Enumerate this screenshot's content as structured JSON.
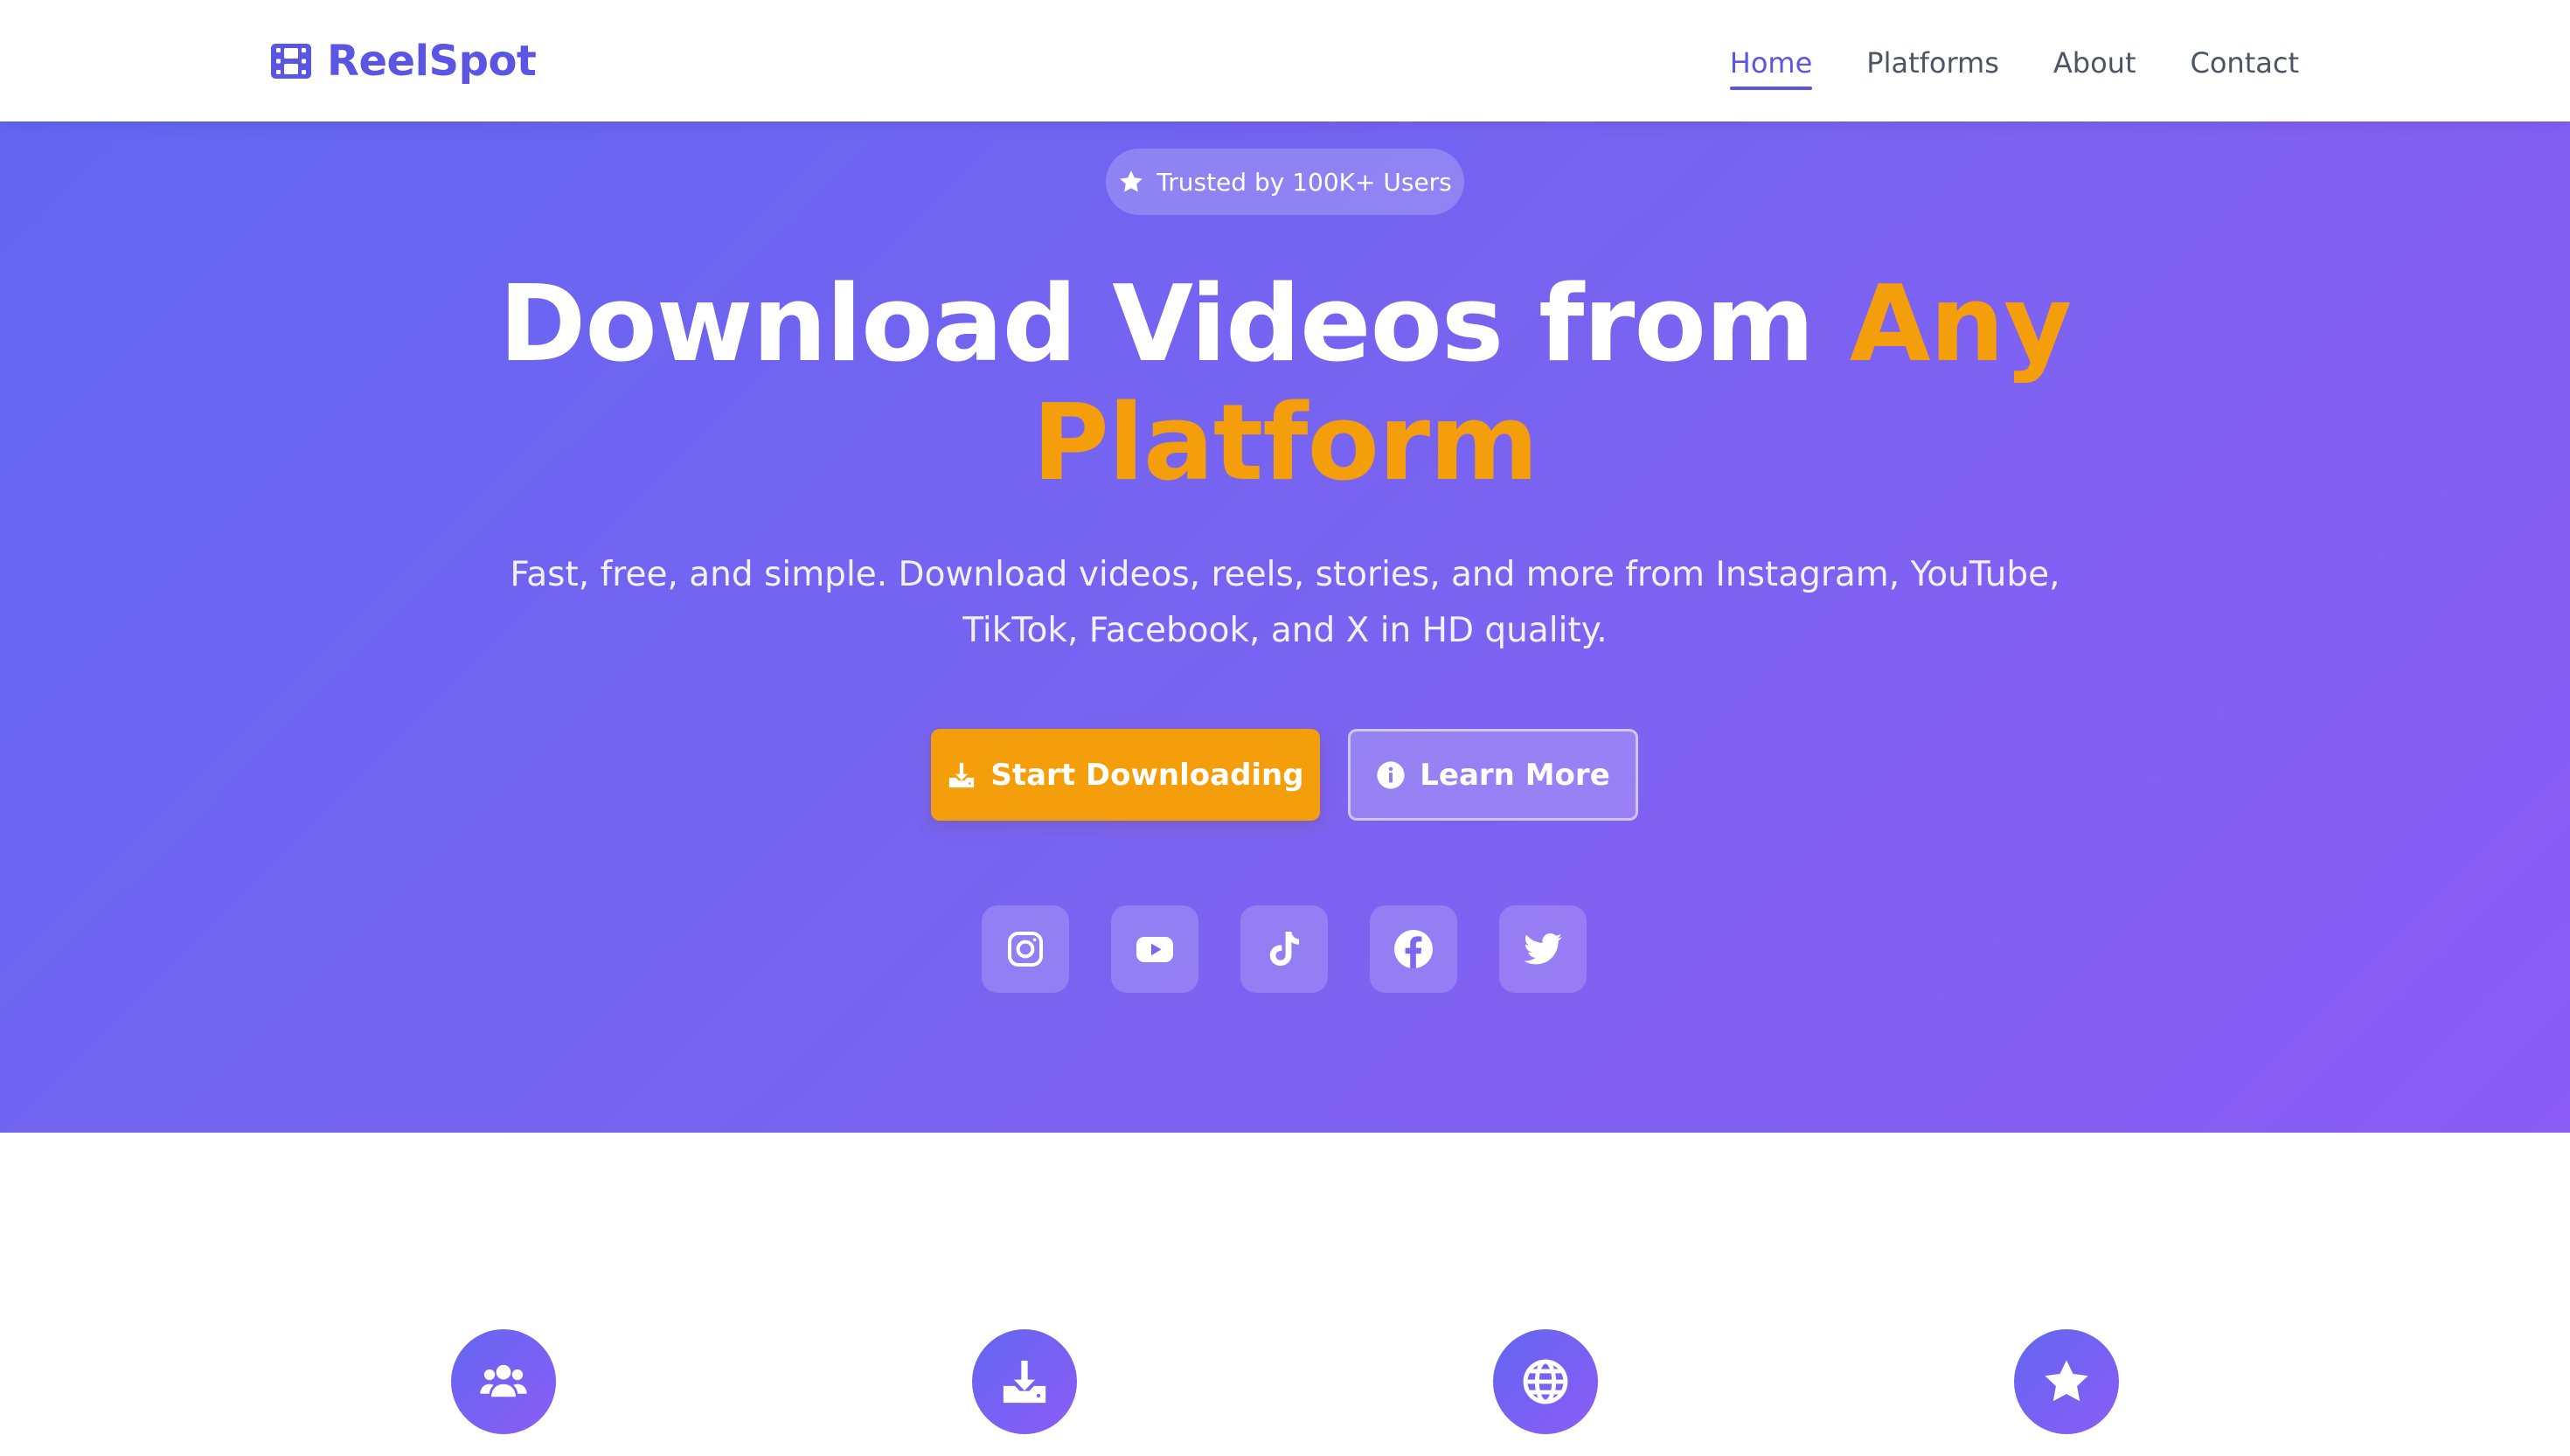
{
  "brand": {
    "name": "ReelSpot",
    "icon": "film-icon",
    "color": "#5b55e3"
  },
  "nav": {
    "items": [
      {
        "label": "Home",
        "active": true
      },
      {
        "label": "Platforms",
        "active": false
      },
      {
        "label": "About",
        "active": false
      },
      {
        "label": "Contact",
        "active": false
      }
    ]
  },
  "hero": {
    "badge": {
      "icon": "star-icon",
      "text": "Trusted by 100K+ Users"
    },
    "title_main": "Download Videos from ",
    "title_accent": "Any Platform",
    "subtitle": "Fast, free, and simple. Download videos, reels, stories, and more from Instagram, YouTube, TikTok, Facebook, and X in HD quality.",
    "primary_button": {
      "label": "Start Downloading",
      "icon": "download-icon"
    },
    "secondary_button": {
      "label": "Learn More",
      "icon": "info-icon"
    },
    "platforms": [
      {
        "name": "Instagram",
        "icon": "instagram-icon"
      },
      {
        "name": "YouTube",
        "icon": "youtube-icon"
      },
      {
        "name": "TikTok",
        "icon": "tiktok-icon"
      },
      {
        "name": "Facebook",
        "icon": "facebook-icon"
      },
      {
        "name": "Twitter",
        "icon": "twitter-icon"
      }
    ]
  },
  "features": {
    "icons": [
      "users-icon",
      "download-icon",
      "globe-icon",
      "star-icon"
    ]
  },
  "colors": {
    "accent": "#f59e0b",
    "gradient_start": "#6366f1",
    "gradient_end": "#8b5cf6",
    "nav_text": "#4b5563"
  }
}
